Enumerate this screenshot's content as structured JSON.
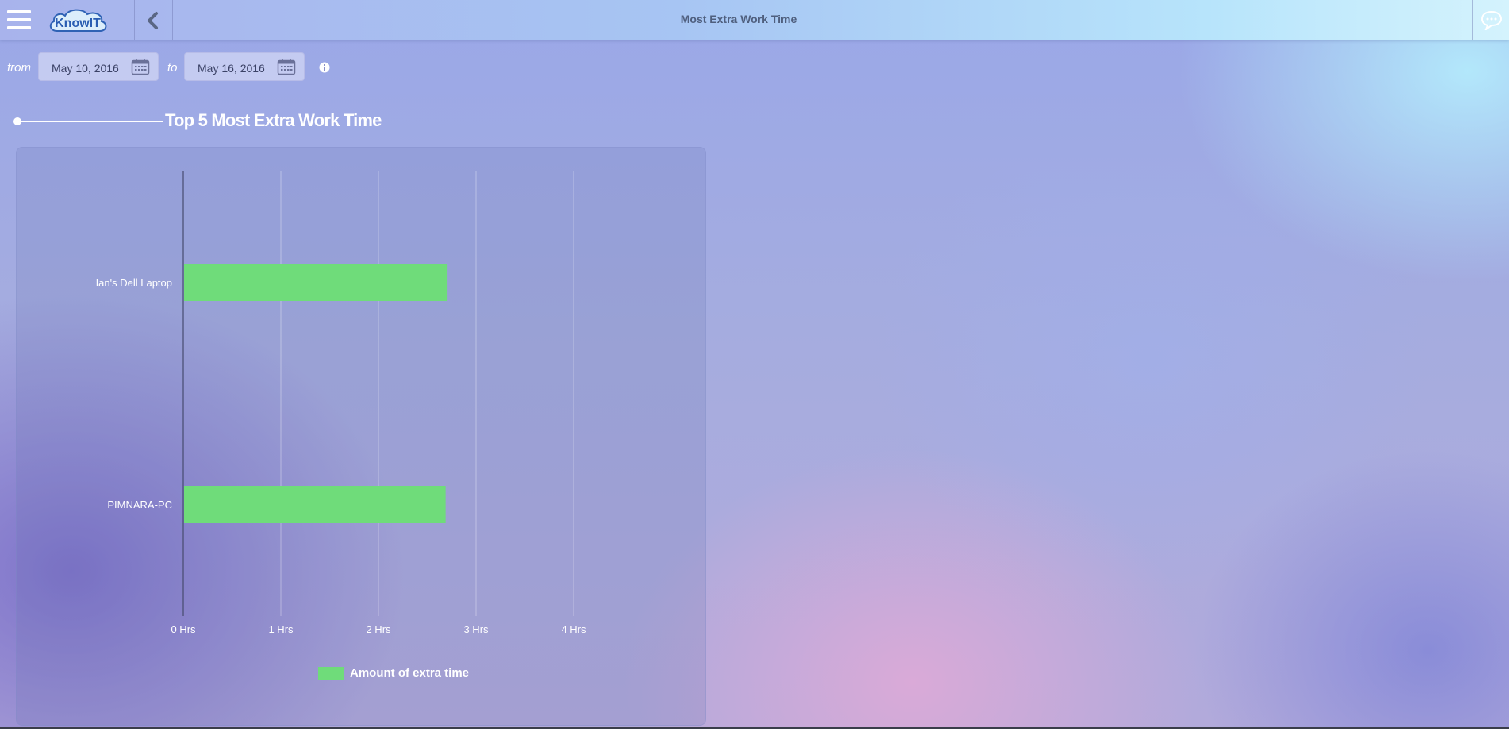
{
  "header": {
    "title": "Most Extra Work Time",
    "logo_text": "KnowIT",
    "icons": {
      "menu": "hamburger-menu-icon",
      "back": "chevron-left-icon",
      "chat": "chat-bubble-icon"
    }
  },
  "date_range": {
    "from_label": "from",
    "from_value": "May 10, 2016",
    "to_label": "to",
    "to_value": "May 16, 2016",
    "calendar_icon": "calendar-icon",
    "info_icon": "info-icon"
  },
  "section": {
    "title": "Top 5 Most Extra Work Time"
  },
  "colors": {
    "bar": "#6fdc7a",
    "header_title": "#4f5f7e",
    "text": "#ffffff"
  },
  "chart_data": {
    "type": "bar",
    "orientation": "horizontal",
    "categories": [
      "Ian's Dell Laptop",
      "PIMNARA-PC"
    ],
    "series": [
      {
        "name": "Amount of extra time",
        "values": [
          2.7,
          2.68
        ]
      }
    ],
    "x_ticks": [
      "0 Hrs",
      "1 Hrs",
      "2 Hrs",
      "3 Hrs",
      "4 Hrs"
    ],
    "xlim": [
      0,
      5
    ],
    "grid": true,
    "legend": "bottom"
  }
}
